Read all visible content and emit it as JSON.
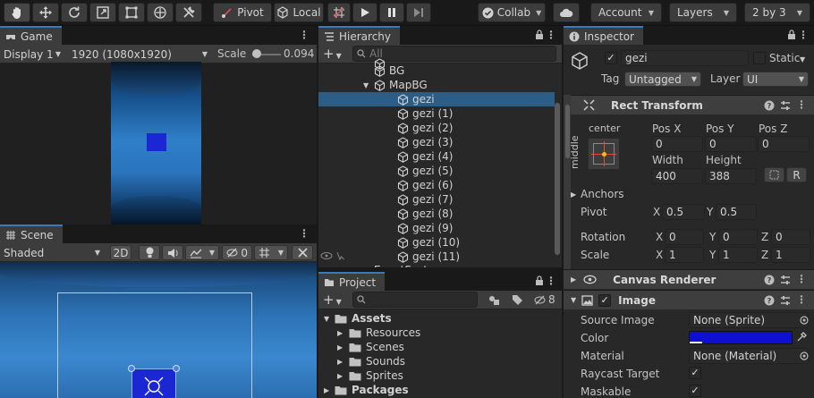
{
  "toolbar": {
    "pivot_label": "Pivot",
    "local_label": "Local",
    "collab_label": "Collab",
    "account_label": "Account",
    "layers_label": "Layers",
    "layout_label": "2 by 3"
  },
  "game": {
    "tab_label": "Game",
    "display": "Display 1",
    "resolution": "1920 (1080x1920)",
    "scale_label": "Scale",
    "scale_value": "0.094"
  },
  "scene": {
    "tab_label": "Scene",
    "shading": "Shaded",
    "mode_2d": "2D",
    "hidden_count": "0"
  },
  "hierarchy": {
    "tab_label": "Hierarchy",
    "search_placeholder": "All",
    "items": [
      {
        "label": "BG",
        "indent": 1,
        "expander": ""
      },
      {
        "label": "MapBG",
        "indent": 1,
        "expander": "▼"
      },
      {
        "label": "gezi",
        "indent": 2,
        "expander": "",
        "selected": true
      },
      {
        "label": "gezi (1)",
        "indent": 2,
        "expander": ""
      },
      {
        "label": "gezi (2)",
        "indent": 2,
        "expander": ""
      },
      {
        "label": "gezi (3)",
        "indent": 2,
        "expander": ""
      },
      {
        "label": "gezi (4)",
        "indent": 2,
        "expander": ""
      },
      {
        "label": "gezi (5)",
        "indent": 2,
        "expander": ""
      },
      {
        "label": "gezi (6)",
        "indent": 2,
        "expander": ""
      },
      {
        "label": "gezi (7)",
        "indent": 2,
        "expander": ""
      },
      {
        "label": "gezi (8)",
        "indent": 2,
        "expander": ""
      },
      {
        "label": "gezi (9)",
        "indent": 2,
        "expander": ""
      },
      {
        "label": "gezi (10)",
        "indent": 2,
        "expander": ""
      },
      {
        "label": "gezi (11)",
        "indent": 2,
        "expander": ""
      }
    ],
    "cut_off_item": "EventSystem"
  },
  "project": {
    "tab_label": "Project",
    "hidden_count": "8",
    "tree": [
      {
        "label": "Assets",
        "level": 0,
        "expander": "▼",
        "bold": true
      },
      {
        "label": "Resources",
        "level": 1,
        "expander": "▶",
        "bold": false
      },
      {
        "label": "Scenes",
        "level": 1,
        "expander": "▶",
        "bold": false
      },
      {
        "label": "Sounds",
        "level": 1,
        "expander": "▶",
        "bold": false
      },
      {
        "label": "Sprites",
        "level": 1,
        "expander": "▶",
        "bold": false
      },
      {
        "label": "Packages",
        "level": 0,
        "expander": "▶",
        "bold": true
      }
    ]
  },
  "inspector": {
    "tab_label": "Inspector",
    "object_name": "gezi",
    "static_label": "Static",
    "tag_label": "Tag",
    "tag_value": "Untagged",
    "layer_label": "Layer",
    "layer_value": "UI",
    "rect_transform": {
      "title": "Rect Transform",
      "anchor_h": "center",
      "anchor_v": "middle",
      "pos_x_label": "Pos X",
      "pos_y_label": "Pos Y",
      "pos_z_label": "Pos Z",
      "pos_x": "0",
      "pos_y": "0",
      "pos_z": "0",
      "width_label": "Width",
      "height_label": "Height",
      "width": "400",
      "height": "388",
      "r_button": "R",
      "anchors_label": "Anchors",
      "pivot_label": "Pivot",
      "pivot_x": "0.5",
      "pivot_y": "0.5",
      "rotation_label": "Rotation",
      "rot_x": "0",
      "rot_y": "0",
      "rot_z": "0",
      "scale_label": "Scale",
      "scale_x": "1",
      "scale_y": "1",
      "scale_z": "1",
      "x": "X",
      "y": "Y",
      "z": "Z"
    },
    "canvas_renderer": {
      "title": "Canvas Renderer"
    },
    "image": {
      "title": "Image",
      "source_image_label": "Source Image",
      "source_image_value": "None (Sprite)",
      "color_label": "Color",
      "color_value": "#0f0fd2",
      "material_label": "Material",
      "material_value": "None (Material)",
      "raycast_label": "Raycast Target",
      "maskable_label": "Maskable"
    }
  },
  "colors": {
    "accent": "#3a79bb",
    "selection": "#2c5d87",
    "image_color": "#0f0fd2"
  }
}
